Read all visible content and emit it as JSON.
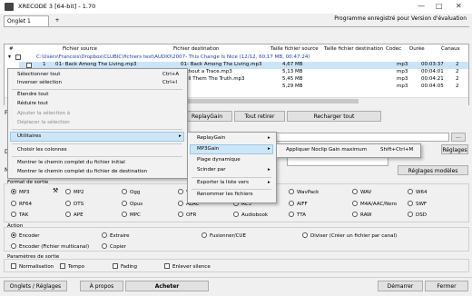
{
  "window": {
    "title": "XRECODE 3 [64-bit] - 1.70"
  },
  "tabs": [
    {
      "label": "Onglet 1"
    }
  ],
  "tab_add": "+",
  "eval_text": "Programme enregistré pour Version d'évaluation",
  "grid": {
    "headers": [
      "#",
      "Fichier source",
      "Fichier destination",
      "Taille fichier source",
      "Taille fichier destination",
      "Codec",
      "Durée",
      "Canaux"
    ],
    "path": "C:\\Users\\Francois\\Dropbox\\CLUBIC\\fichiers test\\AUDIO\\2007- This Change Is Nice (12/12, 60,17 MB, 00:47:24)",
    "rows": [
      {
        "num": "1",
        "src": "01- Back Among The Living.mp3",
        "dst": "01- Back Among The Living.mp3",
        "size": "4,67 MB",
        "codec": "mp3",
        "dur": "00:03:37",
        "ch": "2"
      },
      {
        "num": "",
        "src": "",
        "dst": "ithout a Trace.mp3",
        "size": "5,13 MB",
        "codec": "mp3",
        "dur": "00:04:01",
        "ch": "2"
      },
      {
        "num": "",
        "src": "",
        "dst": "ell Them The Truth.mp3",
        "size": "5,45 MB",
        "codec": "mp3",
        "dur": "00:04:21",
        "ch": "2"
      },
      {
        "num": "",
        "src": "",
        "dst": "",
        "size": "5,29 MB",
        "codec": "mp3",
        "dur": "00:04:05",
        "ch": "2"
      }
    ]
  },
  "toolbar": {
    "replaygain": "ReplayGain",
    "remove_all": "Tout retirer",
    "reload_all": "Recharger tout",
    "browse": "...",
    "rules": "Réglages",
    "models": "Réglages modèles"
  },
  "menu1": {
    "items": [
      {
        "label": "Sélectionner tout",
        "shortcut": "Ctrl+A",
        "disabled": false
      },
      {
        "label": "Inverser sélection",
        "shortcut": "Ctrl+I",
        "disabled": false
      },
      {
        "label": "Étendre tout",
        "shortcut": "",
        "disabled": false
      },
      {
        "label": "Réduire tout",
        "shortcut": "",
        "disabled": false
      },
      {
        "label": "Ajouter la sélection à",
        "shortcut": "",
        "disabled": true
      },
      {
        "label": "Déplacer la sélection",
        "shortcut": "",
        "disabled": true
      },
      {
        "label": "Utilitaires",
        "shortcut": "",
        "disabled": false
      },
      {
        "label": "Choisir les colonnes",
        "shortcut": "",
        "disabled": false
      },
      {
        "label": "Montrer le chemin complet du fichier initial",
        "shortcut": "",
        "disabled": false
      },
      {
        "label": "Montrer le chemin complet du fichier de destination",
        "shortcut": "",
        "disabled": false
      }
    ]
  },
  "menu2": {
    "items": [
      {
        "label": "ReplayGain"
      },
      {
        "label": "MP3Gain"
      },
      {
        "label": "Plage dynamique"
      },
      {
        "label": "Scinder par"
      },
      {
        "label": "Exporter la liste vers"
      },
      {
        "label": "Renommer les fichiers"
      }
    ]
  },
  "menu3": {
    "label": "Appliquer Noclip Gain maximum",
    "shortcut": "Shift+Ctrl+M"
  },
  "side_letters": [
    "F",
    "D",
    "N"
  ],
  "formats": {
    "title": "Format de sortie",
    "options": [
      "MP3",
      "MP2",
      "Ogg",
      "Vo",
      "WavPack",
      "WAV",
      "W64",
      "RF64",
      "DTS",
      "Opus",
      "ALAC",
      "AC3",
      "AIFF",
      "M4A/AAC/Nero",
      "SWF",
      "TAK",
      "APE",
      "MPC",
      "OFR",
      "Audiobook",
      "TTA",
      "RAW",
      "DSD"
    ]
  },
  "action": {
    "title": "Action",
    "options": [
      "Encoder",
      "Extraire",
      "Fusionner/CUE",
      "Diviser (Créer un fichier par canal)",
      "Encoder (Fichier multicanal)",
      "Copier"
    ]
  },
  "output": {
    "title": "Paramètres de sortie",
    "options": [
      "Normalisation",
      "Tempo",
      "Fading",
      "Enlever silence"
    ]
  },
  "footer": {
    "tabs_rules": "Onglets / Réglages",
    "about": "À propos",
    "buy": "Acheter",
    "start": "Démarrer",
    "close": "Fermer"
  },
  "colors": {
    "accent": "#cce4f7",
    "path": "#1d3fa8"
  }
}
